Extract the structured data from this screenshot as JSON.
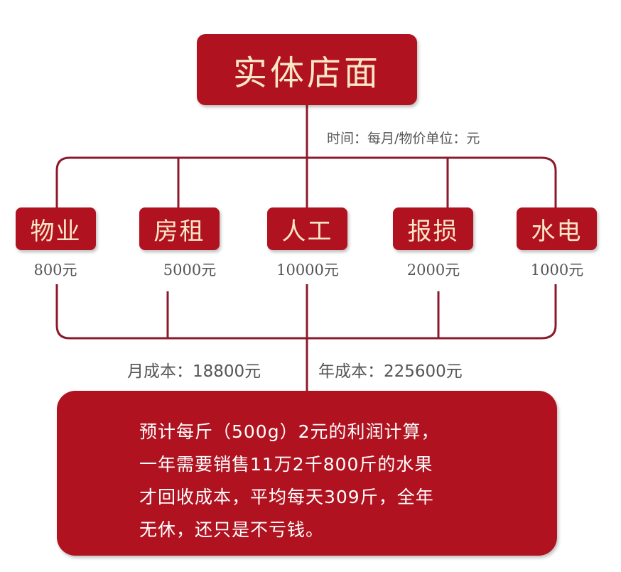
{
  "title": "实体店面",
  "unit_note": "时间：每月/物价单位：元",
  "categories": [
    {
      "label": "物业",
      "amount": "800元"
    },
    {
      "label": "房租",
      "amount": "5000元"
    },
    {
      "label": "人工",
      "amount": "10000元"
    },
    {
      "label": "报损",
      "amount": "2000元"
    },
    {
      "label": "水电",
      "amount": "1000元"
    }
  ],
  "monthly_cost": "月成本：18800元",
  "annual_cost": "年成本：225600元",
  "summary_lines": [
    "预计每斤（500g）2元的利润计算，",
    "一年需要销售11万2千800斤的水果",
    "才回收成本，平均每天309斤，全年",
    "无休，还只是不亏钱。"
  ],
  "colors": {
    "accent": "#b0121f",
    "line": "#8b1a2c",
    "box_text": "#fbe7c6"
  }
}
